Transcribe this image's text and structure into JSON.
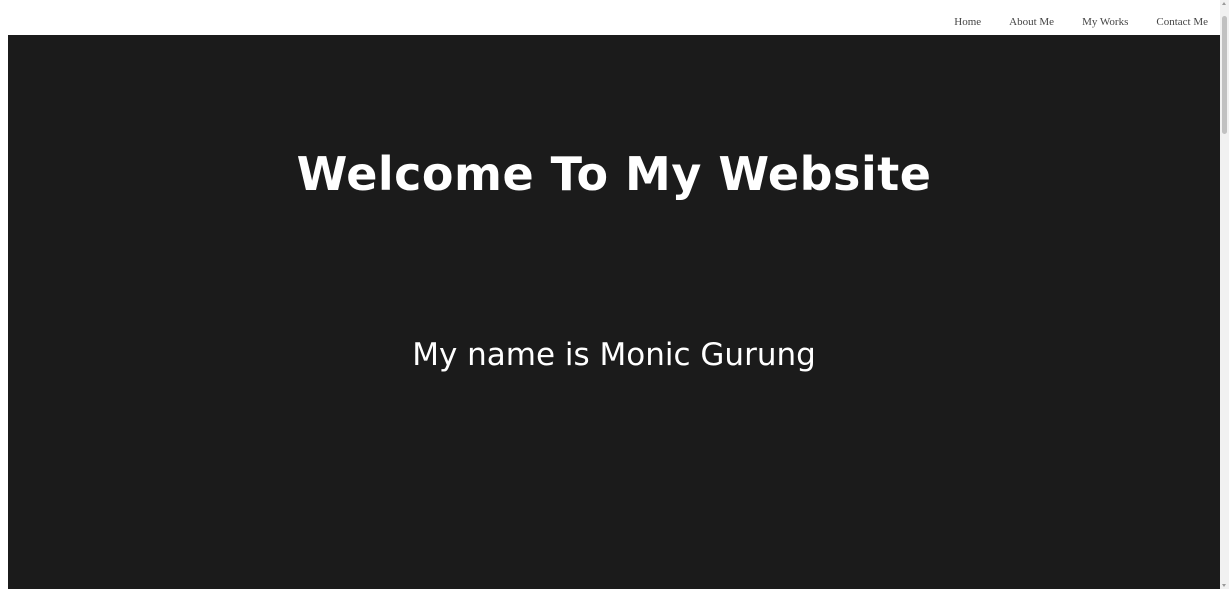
{
  "nav": {
    "items": [
      {
        "label": "Home"
      },
      {
        "label": "About Me"
      },
      {
        "label": "My Works"
      },
      {
        "label": "Contact Me"
      }
    ]
  },
  "hero": {
    "title": "Welcome To My Website",
    "subtitle": "My name is Monic Gurung",
    "background_color": "#1b1b1b",
    "text_color": "#ffffff"
  }
}
